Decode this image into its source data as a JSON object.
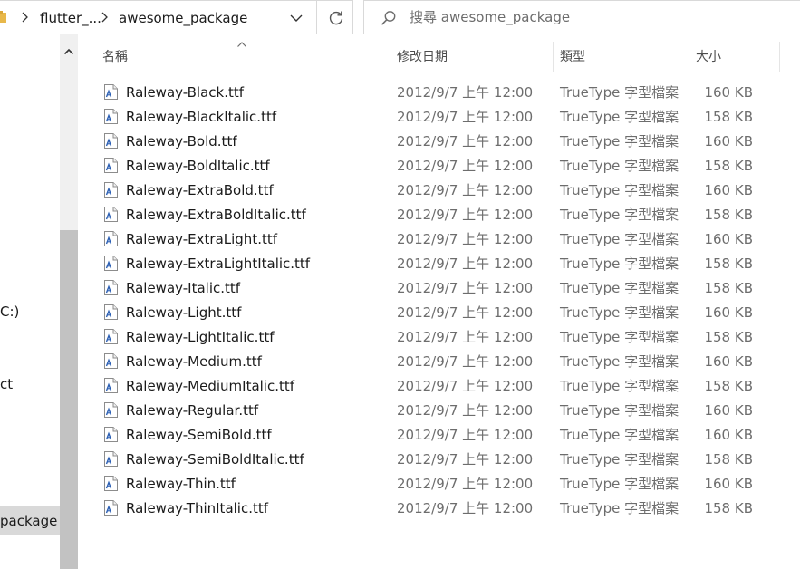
{
  "address": {
    "crumbs": [
      "flutter_...",
      "awesome_package"
    ]
  },
  "search": {
    "placeholder": "搜尋 awesome_package"
  },
  "nav": {
    "items": [
      "C:)",
      "ct",
      "package"
    ]
  },
  "columns": {
    "name": "名稱",
    "date": "修改日期",
    "type": "類型",
    "size": "大小"
  },
  "files": [
    {
      "name": "Raleway-Black.ttf",
      "date": "2012/9/7 上午 12:00",
      "type": "TrueType 字型檔案",
      "size": "160 KB"
    },
    {
      "name": "Raleway-BlackItalic.ttf",
      "date": "2012/9/7 上午 12:00",
      "type": "TrueType 字型檔案",
      "size": "158 KB"
    },
    {
      "name": "Raleway-Bold.ttf",
      "date": "2012/9/7 上午 12:00",
      "type": "TrueType 字型檔案",
      "size": "160 KB"
    },
    {
      "name": "Raleway-BoldItalic.ttf",
      "date": "2012/9/7 上午 12:00",
      "type": "TrueType 字型檔案",
      "size": "158 KB"
    },
    {
      "name": "Raleway-ExtraBold.ttf",
      "date": "2012/9/7 上午 12:00",
      "type": "TrueType 字型檔案",
      "size": "160 KB"
    },
    {
      "name": "Raleway-ExtraBoldItalic.ttf",
      "date": "2012/9/7 上午 12:00",
      "type": "TrueType 字型檔案",
      "size": "158 KB"
    },
    {
      "name": "Raleway-ExtraLight.ttf",
      "date": "2012/9/7 上午 12:00",
      "type": "TrueType 字型檔案",
      "size": "160 KB"
    },
    {
      "name": "Raleway-ExtraLightItalic.ttf",
      "date": "2012/9/7 上午 12:00",
      "type": "TrueType 字型檔案",
      "size": "158 KB"
    },
    {
      "name": "Raleway-Italic.ttf",
      "date": "2012/9/7 上午 12:00",
      "type": "TrueType 字型檔案",
      "size": "158 KB"
    },
    {
      "name": "Raleway-Light.ttf",
      "date": "2012/9/7 上午 12:00",
      "type": "TrueType 字型檔案",
      "size": "160 KB"
    },
    {
      "name": "Raleway-LightItalic.ttf",
      "date": "2012/9/7 上午 12:00",
      "type": "TrueType 字型檔案",
      "size": "158 KB"
    },
    {
      "name": "Raleway-Medium.ttf",
      "date": "2012/9/7 上午 12:00",
      "type": "TrueType 字型檔案",
      "size": "160 KB"
    },
    {
      "name": "Raleway-MediumItalic.ttf",
      "date": "2012/9/7 上午 12:00",
      "type": "TrueType 字型檔案",
      "size": "158 KB"
    },
    {
      "name": "Raleway-Regular.ttf",
      "date": "2012/9/7 上午 12:00",
      "type": "TrueType 字型檔案",
      "size": "160 KB"
    },
    {
      "name": "Raleway-SemiBold.ttf",
      "date": "2012/9/7 上午 12:00",
      "type": "TrueType 字型檔案",
      "size": "160 KB"
    },
    {
      "name": "Raleway-SemiBoldItalic.ttf",
      "date": "2012/9/7 上午 12:00",
      "type": "TrueType 字型檔案",
      "size": "158 KB"
    },
    {
      "name": "Raleway-Thin.ttf",
      "date": "2012/9/7 上午 12:00",
      "type": "TrueType 字型檔案",
      "size": "160 KB"
    },
    {
      "name": "Raleway-ThinItalic.ttf",
      "date": "2012/9/7 上午 12:00",
      "type": "TrueType 字型檔案",
      "size": "158 KB"
    }
  ],
  "icons": {
    "folder": "folder-icon",
    "chevron": "chevron-right-icon",
    "dropdown": "chevron-down-icon",
    "refresh": "refresh-icon",
    "search": "search-icon",
    "sort": "sort-ascending-icon",
    "file": "font-file-icon"
  },
  "colors": {
    "selected": "#d9d9d9",
    "scrollbar_track": "#f0f0f0",
    "scrollbar_thumb": "#c2c2c2",
    "secondary_text": "#6d6d6d",
    "folder": "#e8b84a",
    "font_icon": "#2b5fb4"
  }
}
